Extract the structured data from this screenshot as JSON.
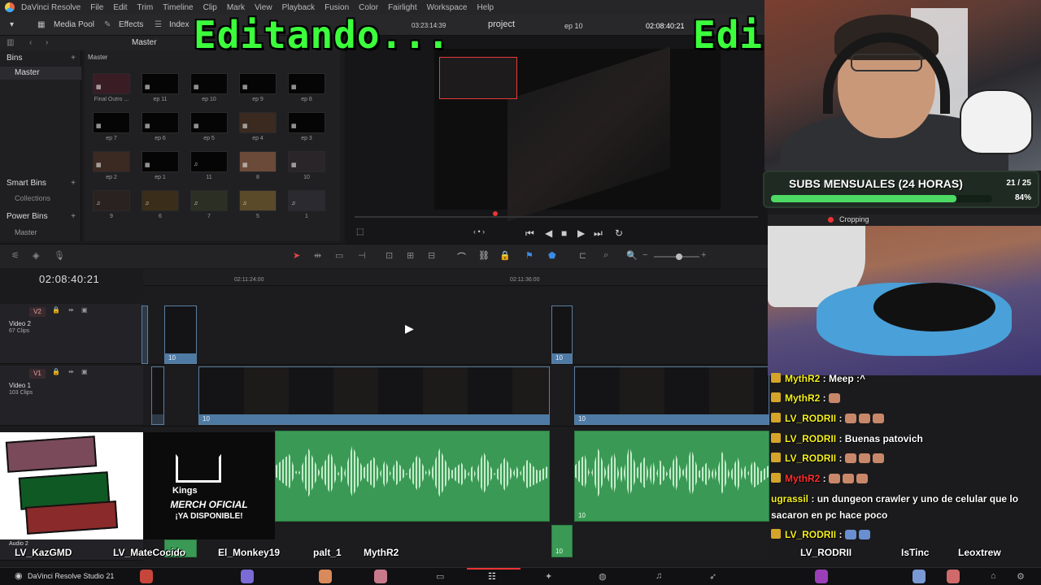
{
  "menubar": {
    "app": "DaVinci Resolve",
    "items": [
      "File",
      "Edit",
      "Trim",
      "Timeline",
      "Clip",
      "Mark",
      "View",
      "Playback",
      "Fusion",
      "Color",
      "Fairlight",
      "Workspace",
      "Help"
    ]
  },
  "toolbar": {
    "media_pool": "Media Pool",
    "effects": "Effects",
    "index": "Index",
    "project": "project",
    "timecode_small": "03:23:14:39",
    "timeline_name": "ep 10",
    "timecode_right": "02:08:40:21"
  },
  "overlay": {
    "editing_text": "Editando...",
    "editing_text_2": "Edi"
  },
  "media_pool": {
    "breadcrumb": "Master",
    "bins_label": "Bins",
    "master_bin": "Master",
    "smart_bins": "Smart Bins",
    "collections": "Collections",
    "power_bins": "Power Bins",
    "power_master": "Master",
    "grid_header": "Master",
    "clips": [
      "Final Outro ...",
      "ep 11",
      "ep 10",
      "ep 9",
      "ep 8",
      "ep 7",
      "ep 6",
      "ep 5",
      "ep 4",
      "ep 3",
      "ep 2",
      "ep 1",
      "11",
      "8",
      "10",
      "9",
      "6",
      "7",
      "5",
      "1"
    ]
  },
  "timeline": {
    "timecode": "02:08:40:21",
    "ruler_marks": [
      "02:11:24:00",
      "02:11:36:00"
    ],
    "tracks": [
      {
        "badge": "V2",
        "name": "Video 2",
        "count": "67 Clips"
      },
      {
        "badge": "V1",
        "name": "Video 1",
        "count": "103 Clips"
      },
      {
        "badge": "",
        "name": "Audio 2",
        "count": ""
      }
    ],
    "clip_label": "10"
  },
  "subs": {
    "title": "SUBS MENSUALES (24 HORAS)",
    "count": "21 / 25",
    "percent_label": "84%",
    "progress": 0.84,
    "bar_color": "#4cd964"
  },
  "cropping": {
    "label": "Cropping"
  },
  "chat": [
    {
      "user": "MythR2",
      "sep": " : ",
      "text": "Meep :^",
      "user_color": "yellow"
    },
    {
      "user": "MythR2",
      "sep": " : ",
      "text": "",
      "user_color": "yellow",
      "emotes": 1
    },
    {
      "user": "LV_RODRII",
      "sep": " : ",
      "text": "",
      "user_color": "yellow",
      "emotes": 3
    },
    {
      "user": "LV_RODRII",
      "sep": " : ",
      "text": "Buenas patovich",
      "user_color": "yellow"
    },
    {
      "user": "LV_RODRII",
      "sep": " : ",
      "text": "",
      "user_color": "yellow",
      "emotes": 3
    },
    {
      "user": "MythR2",
      "sep": " : ",
      "text": "",
      "user_color": "red",
      "emotes": 3
    },
    {
      "user": "ugrassil",
      "sep": " : ",
      "text": "un dungeon crawler y uno de celular que lo sacaron en pc hace poco",
      "user_color": "yellow"
    },
    {
      "user": "LV_RODRII",
      "sep": " : ",
      "text": "",
      "user_color": "yellow",
      "emotes": 2
    }
  ],
  "merch": {
    "brand": "Kings",
    "line1": "MERCH OFICIAL",
    "line2": "¡YA DISPONIBLE!"
  },
  "viewers": [
    "LV_KazGMD",
    "LV_MateCocido",
    "El_Monkey19",
    "palt_1",
    "MythR2",
    "LV_RODRII",
    "IsTinc",
    "Leoxtrew"
  ],
  "taskbar": {
    "app_title": "DaVinci Resolve Studio 21"
  }
}
